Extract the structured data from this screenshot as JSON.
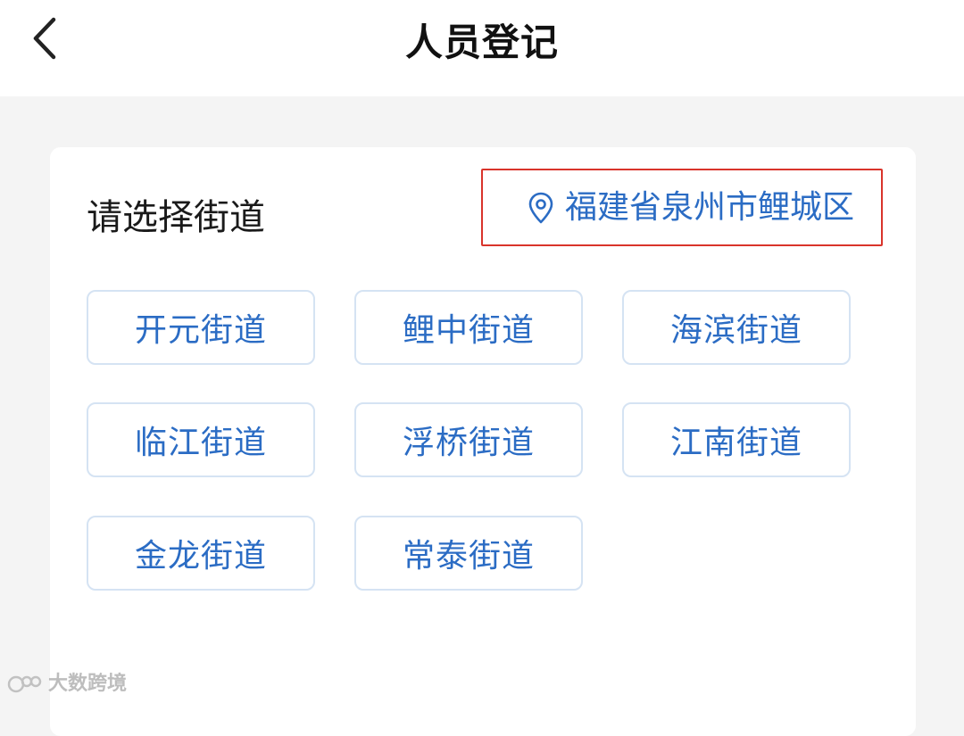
{
  "header": {
    "title": "人员登记",
    "back_icon": "chevron-left-icon"
  },
  "main": {
    "section_label": "请选择街道",
    "location": {
      "icon": "location-pin-icon",
      "text": "福建省泉州市鲤城区",
      "highlight_color": "#d9342b"
    },
    "streets": [
      "开元街道",
      "鲤中街道",
      "海滨街道",
      "临江街道",
      "浮桥街道",
      "江南街道",
      "金龙街道",
      "常泰街道"
    ]
  },
  "watermark": {
    "text": "大数跨境"
  },
  "colors": {
    "accent": "#2b6cc4",
    "button_border": "#d5e3f3",
    "page_background": "#f4f4f4"
  }
}
